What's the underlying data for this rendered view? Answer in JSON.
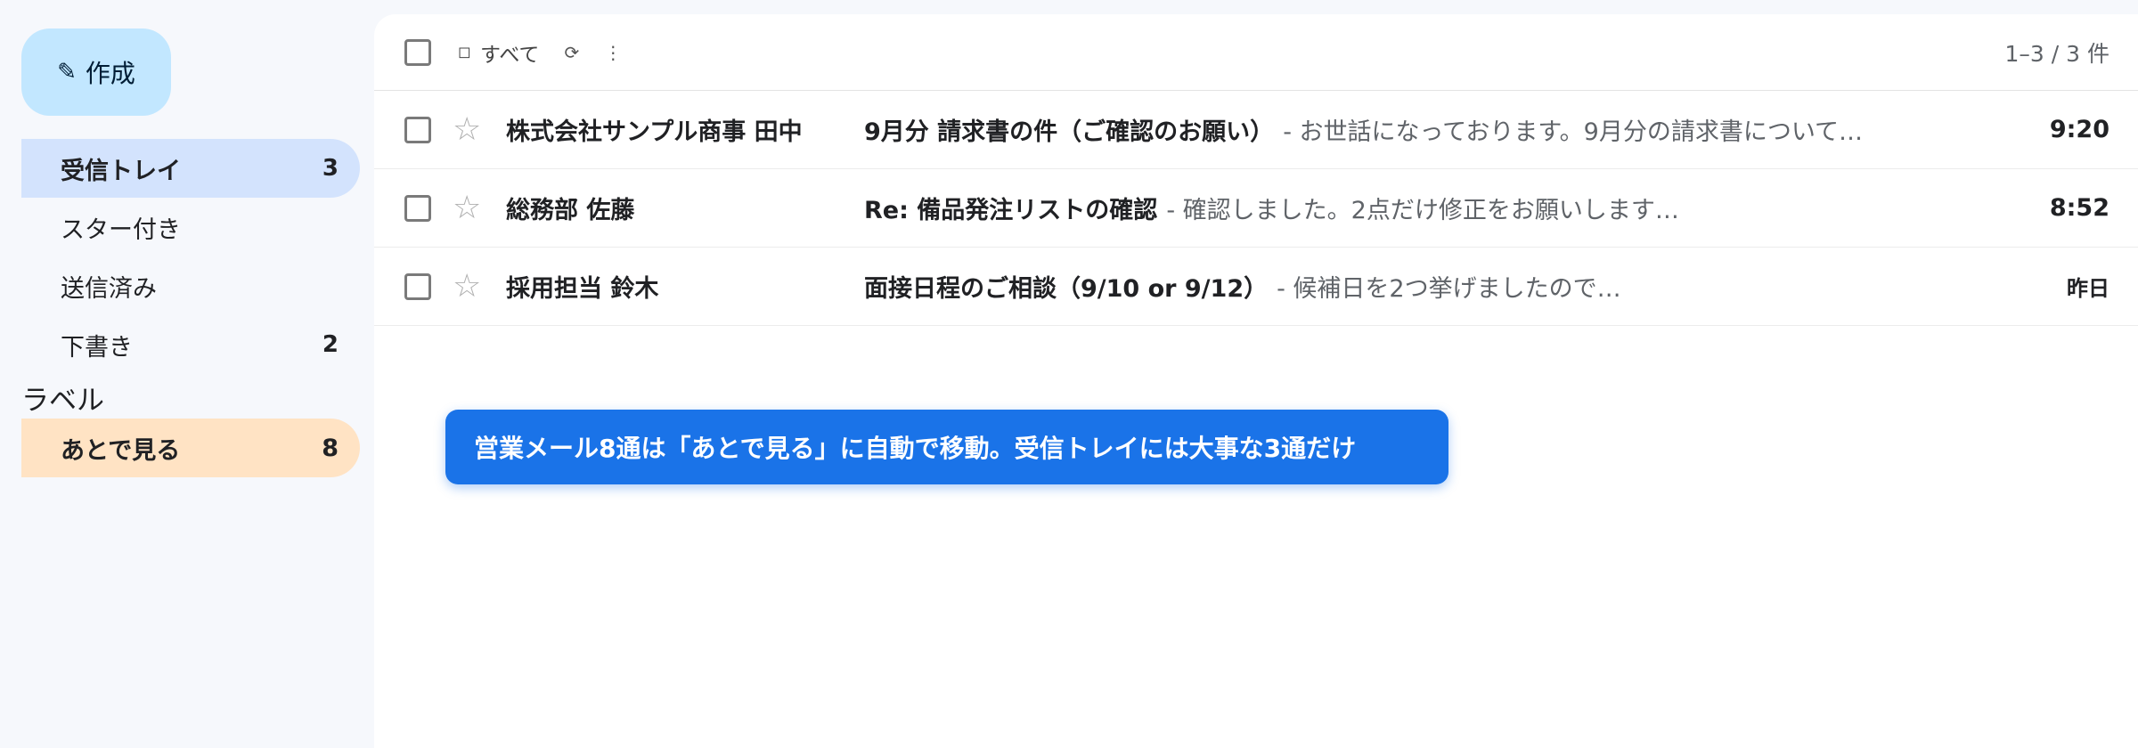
{
  "sidebar": {
    "compose": {
      "icon": "✎",
      "label": "作成"
    },
    "items": [
      {
        "label": "受信トレイ",
        "count": "3"
      },
      {
        "label": "スター付き",
        "count": ""
      },
      {
        "label": "送信済み",
        "count": ""
      },
      {
        "label": "下書き",
        "count": "2"
      }
    ],
    "labels_heading": "ラベル",
    "label_item": {
      "label": "あとで見る",
      "count": "8"
    }
  },
  "toolbar": {
    "select_glyph": "◻",
    "select_label": "すべて",
    "refresh_glyph": "⟳",
    "more_glyph": "⋮",
    "count": "1–3 / 3 件"
  },
  "emails": [
    {
      "sender": "株式会社サンプル商事 田中",
      "subject": "9月分 請求書の件（ご確認のお願い）",
      "snippet": "- お世話になっております。9月分の請求書について…",
      "time": "9:20"
    },
    {
      "sender": "総務部 佐藤",
      "subject": "Re: 備品発注リストの確認",
      "snippet": "- 確認しました。2点だけ修正をお願いします…",
      "time": "8:52"
    },
    {
      "sender": "採用担当 鈴木",
      "subject": "面接日程のご相談（9/10 or 9/12）",
      "snippet": "- 候補日を2つ挙げましたので…",
      "time": "昨日"
    }
  ],
  "toast": "営業メール8通は「あとで見る」に自動で移動。受信トレイには大事な3通だけ",
  "icons": {
    "star": "☆"
  }
}
